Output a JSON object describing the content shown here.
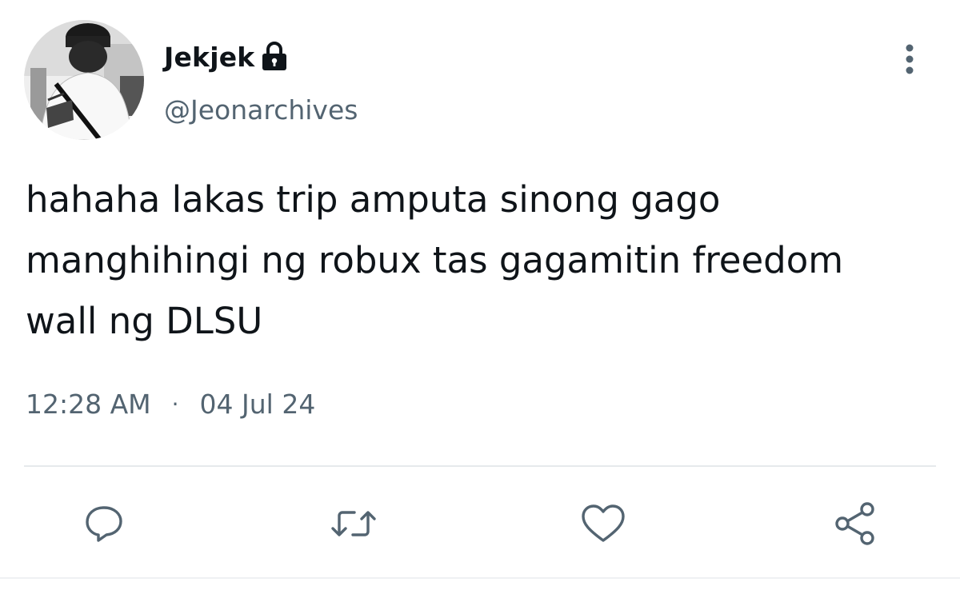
{
  "author": {
    "display_name": "Jekjek",
    "handle": "@Jeonarchives",
    "protected_icon": "lock-icon",
    "avatar": "avatar-photo"
  },
  "tweet": {
    "text": "hahaha lakas trip amputa sinong gago\nmanghihingi ng robux tas gagamitin freedom\nwall ng DLSU",
    "time": "12:28 AM",
    "separator": "·",
    "date": "04 Jul 24"
  },
  "actions": [
    {
      "name": "reply",
      "icon": "reply-icon"
    },
    {
      "name": "retweet",
      "icon": "retweet-icon"
    },
    {
      "name": "like",
      "icon": "heart-icon"
    },
    {
      "name": "share",
      "icon": "share-icon"
    }
  ],
  "menu_icon": "more-vertical-icon",
  "colors": {
    "text": "#0f1419",
    "secondary": "#536471",
    "divider": "#e6e9ec",
    "icon": "#536471"
  }
}
